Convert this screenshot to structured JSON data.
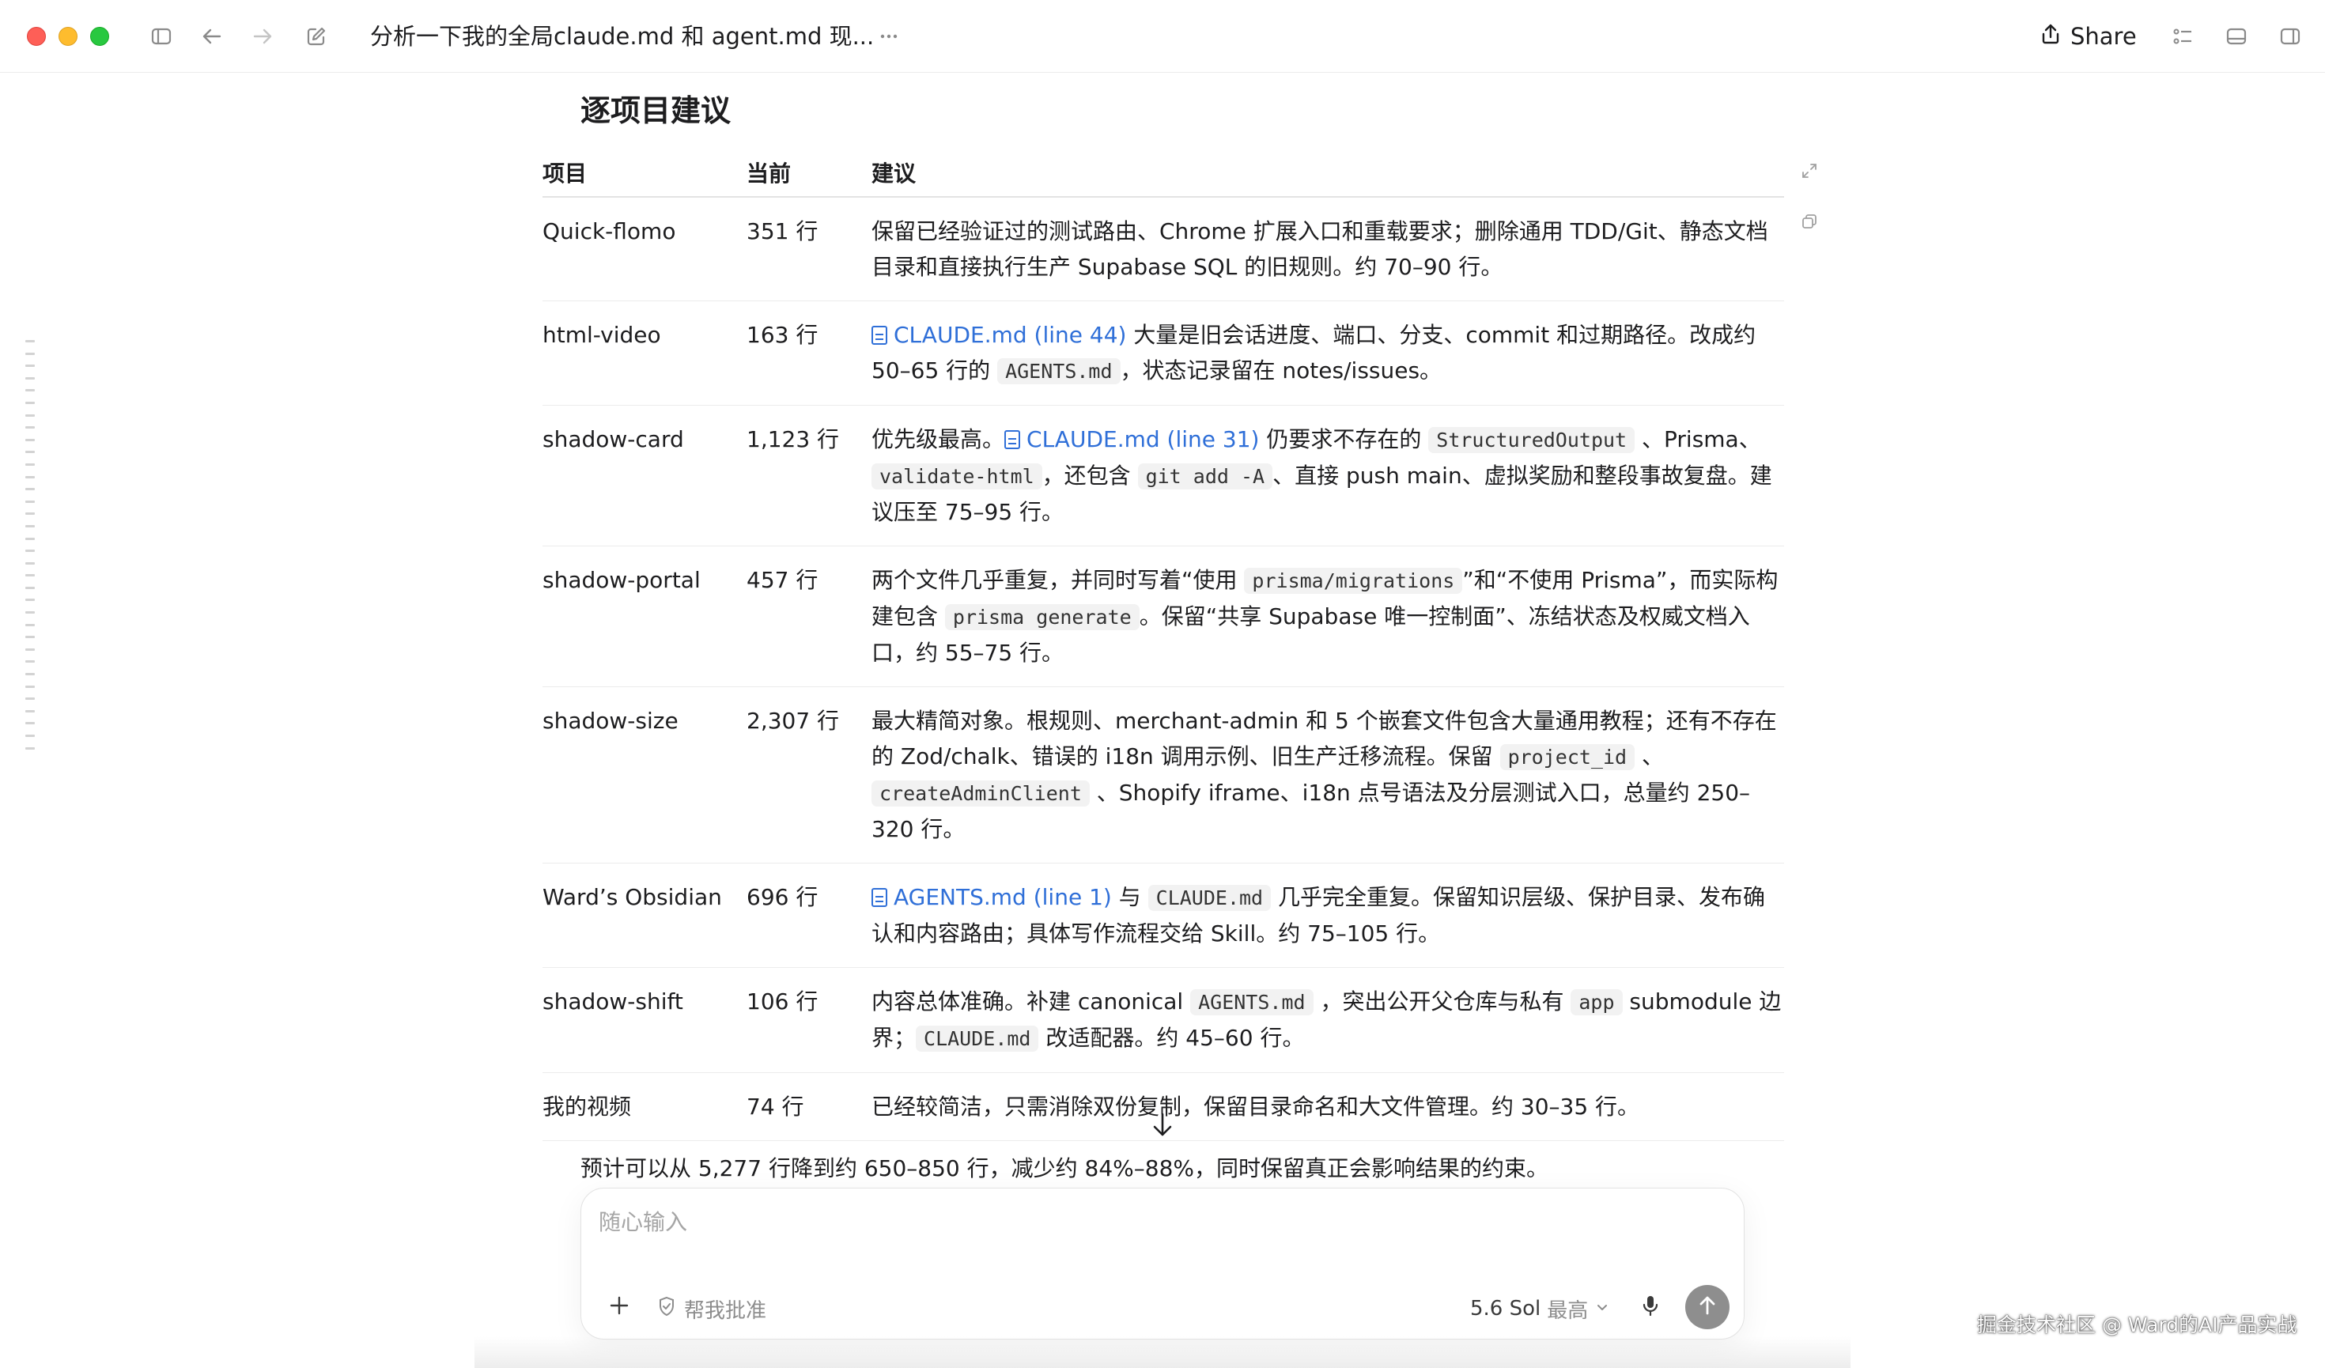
{
  "window": {
    "title": "分析一下我的全局claude.md 和 agent.md 现...",
    "share_label": "Share",
    "icons": [
      "sidebar-icon",
      "back-icon",
      "forward-icon",
      "compose-icon",
      "more-icon",
      "share-icon",
      "checklist-icon",
      "panel-bottom-icon",
      "panel-right-icon"
    ]
  },
  "content": {
    "section_title": "逐项目建议",
    "table": {
      "headers": {
        "project": "项目",
        "current": "当前",
        "advice": "建议"
      },
      "rows": [
        {
          "project": "Quick-flomo",
          "current": "351 行",
          "advice": [
            {
              "t": "text",
              "v": "保留已经验证过的测试路由、Chrome 扩展入口和重载要求；删除通用 TDD/Git、静态文档目录和直接执行生产 Supabase SQL 的旧规则。约 70–90 行。"
            }
          ]
        },
        {
          "project": "html-video",
          "current": "163 行",
          "advice": [
            {
              "t": "link",
              "v": "CLAUDE.md (line 44)"
            },
            {
              "t": "text",
              "v": " 大量是旧会话进度、端口、分支、commit 和过期路径。改成约 50–65 行的 "
            },
            {
              "t": "code",
              "v": "AGENTS.md"
            },
            {
              "t": "text",
              "v": "，状态记录留在 notes/issues。"
            }
          ]
        },
        {
          "project": "shadow-card",
          "current": "1,123 行",
          "advice": [
            {
              "t": "text",
              "v": "优先级最高。"
            },
            {
              "t": "link",
              "v": "CLAUDE.md (line 31)"
            },
            {
              "t": "text",
              "v": " 仍要求不存在的 "
            },
            {
              "t": "code",
              "v": "StructuredOutput"
            },
            {
              "t": "text",
              "v": " 、Prisma、"
            },
            {
              "t": "code",
              "v": "validate-html"
            },
            {
              "t": "text",
              "v": "，还包含 "
            },
            {
              "t": "code",
              "v": "git add -A"
            },
            {
              "t": "text",
              "v": "、直接 push main、虚拟奖励和整段事故复盘。建议压至 75–95 行。"
            }
          ]
        },
        {
          "project": "shadow-portal",
          "current": "457 行",
          "advice": [
            {
              "t": "text",
              "v": "两个文件几乎重复，并同时写着“使用 "
            },
            {
              "t": "code",
              "v": "prisma/migrations"
            },
            {
              "t": "text",
              "v": "”和“不使用 Prisma”，而实际构建包含 "
            },
            {
              "t": "code",
              "v": "prisma generate"
            },
            {
              "t": "text",
              "v": "。保留“共享 Supabase 唯一控制面”、冻结状态及权威文档入口，约 55–75 行。"
            }
          ]
        },
        {
          "project": "shadow-size",
          "current": "2,307 行",
          "advice": [
            {
              "t": "text",
              "v": "最大精简对象。根规则、merchant-admin 和 5 个嵌套文件包含大量通用教程；还有不存在的 Zod/chalk、错误的 i18n 调用示例、旧生产迁移流程。保留 "
            },
            {
              "t": "code",
              "v": "project_id"
            },
            {
              "t": "text",
              "v": " 、"
            },
            {
              "t": "code",
              "v": "createAdminClient"
            },
            {
              "t": "text",
              "v": " 、Shopify iframe、i18n 点号语法及分层测试入口，总量约 250–320 行。"
            }
          ]
        },
        {
          "project": "Ward’s Obsidian",
          "current": "696 行",
          "advice": [
            {
              "t": "link",
              "v": "AGENTS.md (line 1)"
            },
            {
              "t": "text",
              "v": " 与 "
            },
            {
              "t": "code",
              "v": "CLAUDE.md"
            },
            {
              "t": "text",
              "v": " 几乎完全重复。保留知识层级、保护目录、发布确认和内容路由；具体写作流程交给 Skill。约 75–105 行。"
            }
          ]
        },
        {
          "project": "shadow-shift",
          "current": "106 行",
          "advice": [
            {
              "t": "text",
              "v": "内容总体准确。补建 canonical "
            },
            {
              "t": "code",
              "v": "AGENTS.md"
            },
            {
              "t": "text",
              "v": " ，突出公开父仓库与私有 "
            },
            {
              "t": "code",
              "v": "app"
            },
            {
              "t": "text",
              "v": " submodule 边界；"
            },
            {
              "t": "code",
              "v": "CLAUDE.md"
            },
            {
              "t": "text",
              "v": " 改适配器。约 45–60 行。"
            }
          ]
        },
        {
          "project": "我的视频",
          "current": "74 行",
          "advice": [
            {
              "t": "text",
              "v": "已经较简洁，只需消除双份复制，保留目录命名和大文件管理。约 30–35 行。"
            }
          ]
        }
      ]
    },
    "summary": "预计可以从 5,277 行降到约 650–850 行，减少约 84%–88%，同时保留真正会影响结果的约束。"
  },
  "composer": {
    "placeholder": "随心输入",
    "value": "",
    "approve_label": "帮我批准",
    "model_label": "5.6 Sol",
    "effort_label": "最高"
  },
  "watermark": "掘金技术社区 @ Ward的AI产品实战"
}
